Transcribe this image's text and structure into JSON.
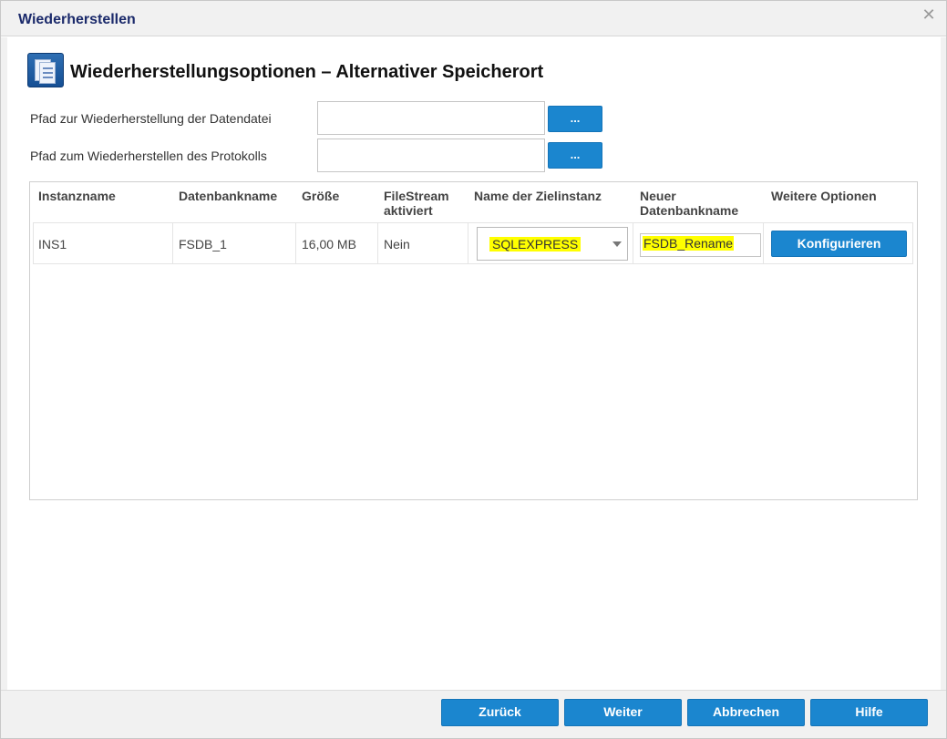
{
  "dialog": {
    "title": "Wiederherstellen",
    "close_icon": "close-icon",
    "header_icon": "document-stack-icon",
    "page_title": "Wiederherstellungsoptionen – Alternativer Speicherort"
  },
  "paths": {
    "data_file_label": "Pfad zur Wiederherstellung der Datendatei",
    "data_file_value": "",
    "data_file_browse": "...",
    "log_label": "Pfad zum Wiederherstellen des Protokolls",
    "log_value": "",
    "log_browse": "..."
  },
  "grid": {
    "columns": [
      {
        "line1": "Instanzname",
        "line2": ""
      },
      {
        "line1": "Datenbankname",
        "line2": ""
      },
      {
        "line1": "Größe",
        "line2": ""
      },
      {
        "line1": "FileStream",
        "line2": "aktiviert"
      },
      {
        "line1": "Name der Zielinstanz",
        "line2": ""
      },
      {
        "line1": "Neuer",
        "line2": "Datenbankname"
      },
      {
        "line1": "Weitere Optionen",
        "line2": ""
      }
    ],
    "rows": [
      {
        "instance": "INS1",
        "database": "FSDB_1",
        "size": "16,00 MB",
        "filestream": "Nein",
        "target_instance": "SQLEXPRESS",
        "new_db_name": "FSDB_Rename",
        "configure_label": "Konfigurieren"
      }
    ]
  },
  "footer": {
    "back_label": "Zurück",
    "next_label": "Weiter",
    "cancel_label": "Abbrechen",
    "help_label": "Hilfe"
  },
  "colors": {
    "button_blue": "#1b86cf",
    "highlight": "#ffff00",
    "title_blue": "#1b2a6b",
    "chrome_gray": "#f1f1f1"
  }
}
